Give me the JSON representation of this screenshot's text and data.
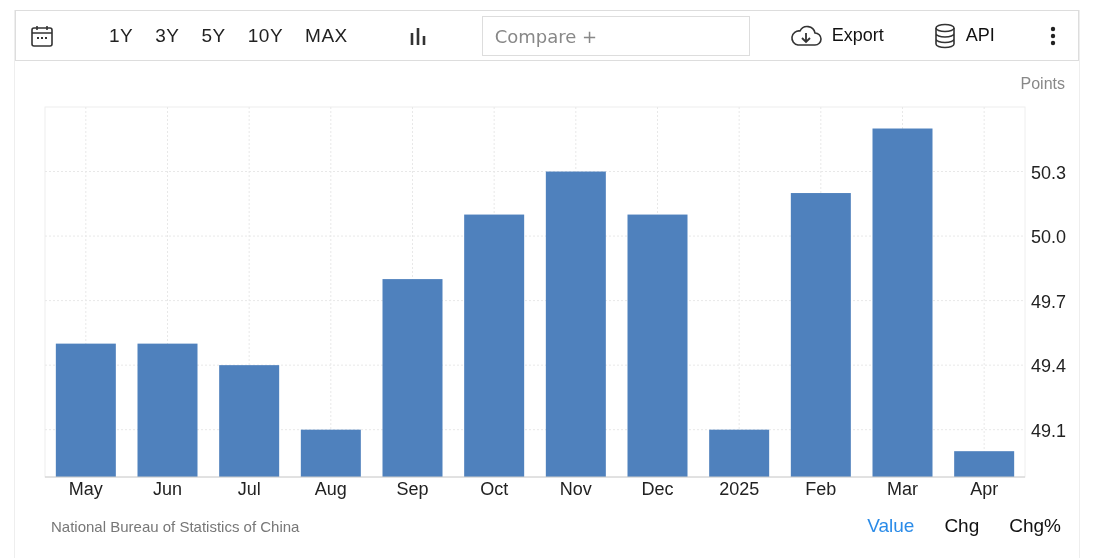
{
  "toolbar": {
    "ranges": [
      {
        "label": "1Y",
        "selected": false
      },
      {
        "label": "3Y",
        "selected": false
      },
      {
        "label": "5Y",
        "selected": false
      },
      {
        "label": "10Y",
        "selected": false
      },
      {
        "label": "MAX",
        "selected": false
      }
    ],
    "compare": {
      "placeholder": "Compare +"
    },
    "export_label": "Export",
    "api_label": "API"
  },
  "chart": {
    "unit": "Points",
    "chart_data": {
      "type": "bar",
      "categories": [
        "May",
        "Jun",
        "Jul",
        "Aug",
        "Sep",
        "Oct",
        "Nov",
        "Dec",
        "2025",
        "Feb",
        "Mar",
        "Apr"
      ],
      "grid": true,
      "series": [
        {
          "color": "#4f81bd",
          "values": [
            49.5,
            49.5,
            49.4,
            49.1,
            49.8,
            50.1,
            50.3,
            50.1,
            49.1,
            50.2,
            50.5,
            49.0
          ]
        }
      ],
      "ylim": [
        48.88,
        50.6
      ],
      "yticks": [
        {
          "value": 49.1,
          "label": "49.1"
        },
        {
          "value": 49.4,
          "label": "49.4"
        },
        {
          "value": 49.7,
          "label": "49.7"
        },
        {
          "value": 50.0,
          "label": "50.0"
        },
        {
          "value": 50.3,
          "label": "50.3"
        }
      ]
    }
  },
  "source": "National Bureau of Statistics of China",
  "views": [
    {
      "label": "Value",
      "selected": true
    },
    {
      "label": "Chg",
      "selected": false
    },
    {
      "label": "Chg%",
      "selected": false
    }
  ]
}
